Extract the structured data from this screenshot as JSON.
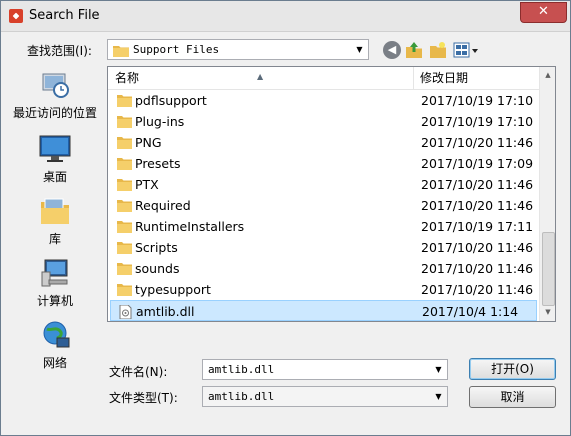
{
  "window": {
    "title": "Search File",
    "close_glyph": "✕"
  },
  "lookin": {
    "label": "查找范围(I):",
    "value": "Support Files"
  },
  "places": [
    {
      "label": "最近访问的位置",
      "icon": "recent-places-icon"
    },
    {
      "label": "桌面",
      "icon": "desktop-icon"
    },
    {
      "label": "库",
      "icon": "libraries-icon"
    },
    {
      "label": "计算机",
      "icon": "computer-icon"
    },
    {
      "label": "网络",
      "icon": "network-icon"
    }
  ],
  "columns": {
    "name": "名称",
    "date": "修改日期"
  },
  "files": [
    {
      "name": "pdflsupport",
      "date": "2017/10/19 17:10",
      "type": "folder"
    },
    {
      "name": "Plug-ins",
      "date": "2017/10/19 17:10",
      "type": "folder"
    },
    {
      "name": "PNG",
      "date": "2017/10/20 11:46",
      "type": "folder"
    },
    {
      "name": "Presets",
      "date": "2017/10/19 17:09",
      "type": "folder"
    },
    {
      "name": "PTX",
      "date": "2017/10/20 11:46",
      "type": "folder"
    },
    {
      "name": "Required",
      "date": "2017/10/20 11:46",
      "type": "folder"
    },
    {
      "name": "RuntimeInstallers",
      "date": "2017/10/19 17:11",
      "type": "folder"
    },
    {
      "name": "Scripts",
      "date": "2017/10/20 11:46",
      "type": "folder"
    },
    {
      "name": "sounds",
      "date": "2017/10/20 11:46",
      "type": "folder"
    },
    {
      "name": "typesupport",
      "date": "2017/10/20 11:46",
      "type": "folder"
    },
    {
      "name": "amtlib.dll",
      "date": "2017/10/4 1:14",
      "type": "dll",
      "selected": true
    }
  ],
  "filename": {
    "label": "文件名(N):",
    "value": "amtlib.dll"
  },
  "filetype": {
    "label": "文件类型(T):",
    "value": "amtlib.dll"
  },
  "buttons": {
    "open": "打开(O)",
    "cancel": "取消"
  },
  "colors": {
    "selection": "#cce8ff",
    "folder": "#e8b84a",
    "close": "#c75050"
  }
}
